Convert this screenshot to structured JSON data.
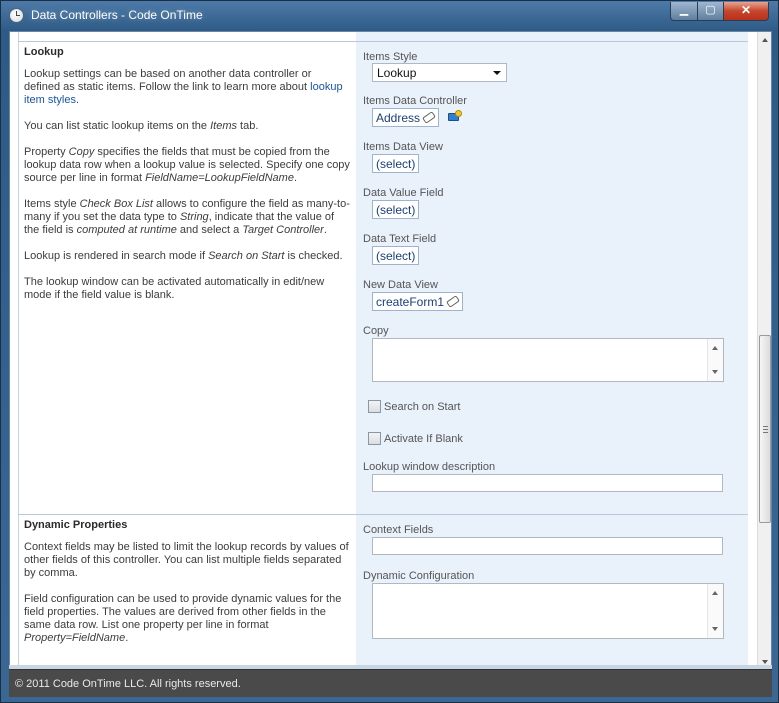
{
  "window": {
    "title": "Data Controllers - Code OnTime",
    "minimize_label": "▁",
    "maximize_label": "▢",
    "close_label": "✕"
  },
  "lookup": {
    "section_title": "Lookup",
    "p1_before_link": "Lookup settings can be based on another data controller or defined as static items. Follow the link to learn more about ",
    "p1_link": "lookup item styles",
    "p1_after_link": ".",
    "p2_before": "You can list static lookup items on the ",
    "p2_em": "Items",
    "p2_after": " tab.",
    "p3_a": "Property ",
    "p3_em1": "Copy",
    "p3_b": " specifies the fields that must be copied from the lookup data row when a lookup value is selected. Specify one copy source per line in format ",
    "p3_em2": "FieldName=LookupFieldName",
    "p3_c": ".",
    "p4_a": "Items style ",
    "p4_em1": "Check Box List",
    "p4_b": " allows to configure the field as many-to-many if you set the data type to ",
    "p4_em2": "String",
    "p4_c": ", indicate that the value of the field is ",
    "p4_em3": "computed at runtime",
    "p4_d": " and select a ",
    "p4_em4": "Target Controller",
    "p4_e": ".",
    "p5_a": "Lookup is rendered in search mode if ",
    "p5_em": "Search on Start",
    "p5_b": " is checked.",
    "p6": "The lookup window can be activated automatically in edit/new mode if the field value is blank."
  },
  "lookup_form": {
    "items_style_label": "Items Style",
    "items_style_value": "Lookup",
    "items_data_controller_label": "Items Data Controller",
    "items_data_controller_value": "Address",
    "items_data_view_label": "Items Data View",
    "items_data_view_value": "(select)",
    "data_value_field_label": "Data Value Field",
    "data_value_field_value": "(select)",
    "data_text_field_label": "Data Text Field",
    "data_text_field_value": "(select)",
    "new_data_view_label": "New Data View",
    "new_data_view_value": "createForm1",
    "copy_label": "Copy",
    "copy_value": "",
    "search_on_start_label": "Search on Start",
    "search_on_start_checked": false,
    "activate_if_blank_label": "Activate If Blank",
    "activate_if_blank_checked": false,
    "lookup_window_description_label": "Lookup window description",
    "lookup_window_description_value": ""
  },
  "dynamic": {
    "section_title": "Dynamic Properties",
    "p1": "Context fields may be listed to limit the lookup records by values of other fields of this controller. You can list multiple fields separated by comma.",
    "p2_a": "Field configuration can be used to provide dynamic values for the field properties. The values are derived from other fields in the same data row. List one property per line in format ",
    "p2_em": "Property=FieldName",
    "p2_b": "."
  },
  "dynamic_form": {
    "context_fields_label": "Context Fields",
    "context_fields_value": "",
    "dynamic_configuration_label": "Dynamic Configuration",
    "dynamic_configuration_value": ""
  },
  "footer": {
    "copyright": "© 2011 Code OnTime LLC. All rights reserved."
  },
  "icons": {
    "app": "clock-icon",
    "edit": "pencil-icon",
    "controller": "database-folder-icon"
  }
}
